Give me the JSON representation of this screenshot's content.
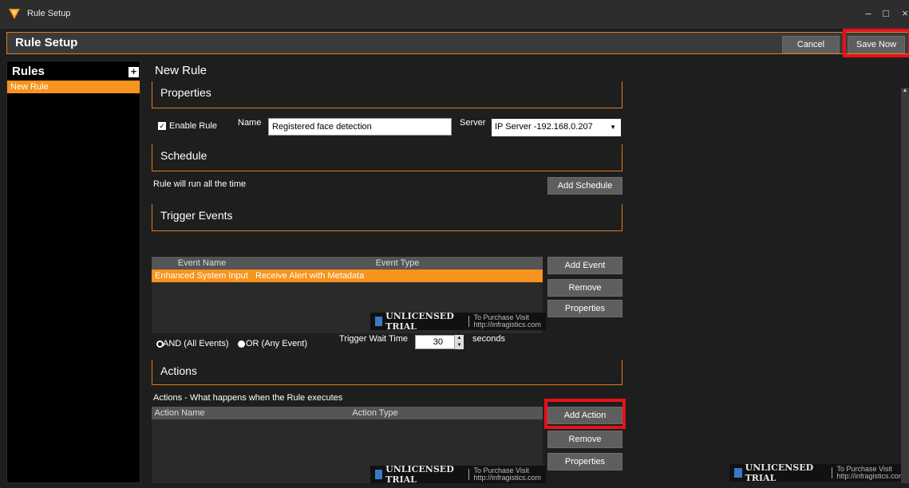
{
  "window": {
    "title": "Rule Setup",
    "controls": {
      "minimize": "–",
      "maximize": "□",
      "close": "×"
    }
  },
  "header": {
    "title": "Rule Setup",
    "cancel_label": "Cancel",
    "save_label": "Save Now"
  },
  "sidebar": {
    "title": "Rules",
    "add_icon": "+",
    "items": [
      {
        "label": "New Rule"
      }
    ]
  },
  "main": {
    "title": "New Rule",
    "properties": {
      "section_title": "Properties",
      "enable_rule_label": "Enable Rule",
      "enable_rule_checked": true,
      "name_label": "Name",
      "name_value": "Registered face detection",
      "server_label": "Server",
      "server_value": "IP Server -192.168.0.207"
    },
    "schedule": {
      "section_title": "Schedule",
      "status_text": "Rule will run all the time",
      "add_label": "Add Schedule"
    },
    "trigger": {
      "section_title": "Trigger Events",
      "columns": [
        "Event Name",
        "Event Type"
      ],
      "rows": [
        {
          "event_name": "Enhanced System Input",
          "event_type": "Receive Alert with Metadata"
        }
      ],
      "add_label": "Add Event",
      "remove_label": "Remove",
      "properties_label": "Properties",
      "and_label": "AND (All Events)",
      "or_label": "OR (Any Event)",
      "mode": "AND",
      "wait_label": "Trigger Wait Time",
      "wait_value": "30",
      "wait_unit": "seconds"
    },
    "actions": {
      "section_title": "Actions",
      "description": "Actions - What happens when the Rule executes",
      "columns": [
        "Action Name",
        "Action Type"
      ],
      "add_label": "Add Action",
      "remove_label": "Remove",
      "properties_label": "Properties"
    }
  },
  "trial_banner": {
    "text": "UNLICENSED TRIAL",
    "line1": "To Purchase Visit",
    "line2": "http://infragistics.com"
  },
  "colors": {
    "accent": "#f7931e",
    "border": "#e07b1a",
    "highlight": "#e8101a",
    "background": "#1e1e1e"
  }
}
